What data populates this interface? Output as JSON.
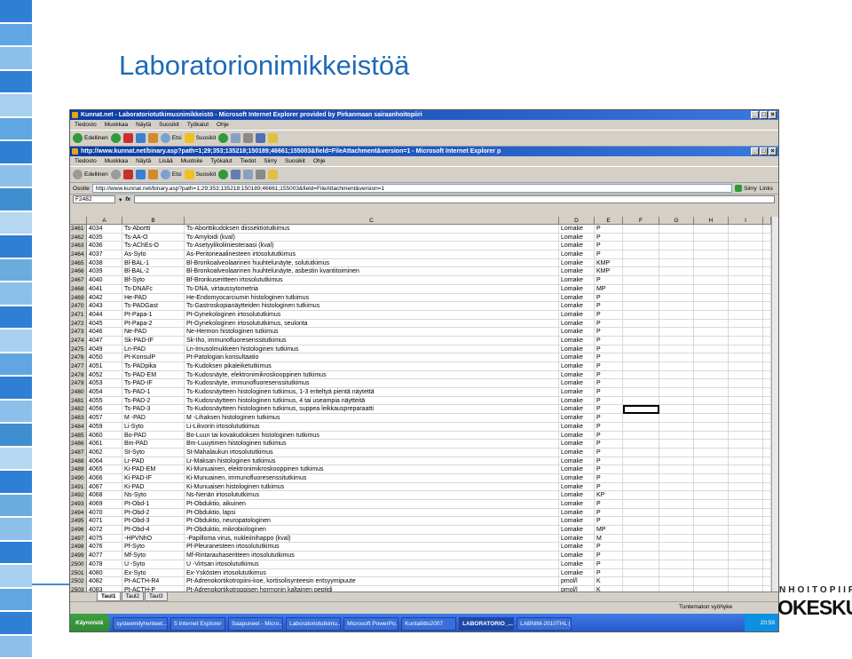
{
  "slide": {
    "title": "Laboratorionimikkeistöä"
  },
  "logo": {
    "top": "NHOITOPIIRI",
    "bottom": "OKESKUS"
  },
  "colors": {
    "stripe": [
      "#2f7fd4",
      "#5fa6e2",
      "#8cc0ea",
      "#2f7fd4",
      "#a8d0f0",
      "#5fa6e2",
      "#2f7fd4",
      "#8cc0ea",
      "#3f8fd0",
      "#b5d7f2",
      "#2f7fd4",
      "#6aacde",
      "#8cc0ea",
      "#2f7fd4",
      "#a8d0f0",
      "#5fa6e2",
      "#2f7fd4",
      "#8cc0ea",
      "#3f8fd0",
      "#b5d7f2",
      "#2f7fd4",
      "#6aacde",
      "#8cc0ea",
      "#2f7fd4",
      "#a8d0f0",
      "#5fa6e2",
      "#2f7fd4",
      "#8cc0ea"
    ],
    "accent": "#1e6ab8"
  },
  "browser1": {
    "title": "Kunnat.net - Laboratoriotutkimusnimikkeistö - Microsoft Internet Explorer provided by Pirkanmaan sairaanhoitopiiri",
    "menu": [
      "Tiedosto",
      "Muokkaa",
      "Näytä",
      "Suosikit",
      "Työkalut",
      "Ohje"
    ],
    "toolbar": {
      "back": "Edellinen",
      "search": "Etsi",
      "favorites": "Suosikit"
    }
  },
  "browser2": {
    "title": "http://www.kunnat.net/binary.asp?path=1;29;353;135218;150189;46661;155003&field=FileAttachment&version=1 - Microsoft Internet Explorer p",
    "menu": [
      "Tiedosto",
      "Muokkaa",
      "Näytä",
      "Lisää",
      "Muotoile",
      "Työkalut",
      "Tiedot",
      "Siirry",
      "Suosikit",
      "Ohje"
    ],
    "toolbar": {
      "back": "Edellinen",
      "search": "Etsi",
      "favorites": "Suosikit"
    },
    "address_label": "Osoite",
    "address": "http://www.kunnat.net/binary.asp?path=1;29;353;135218;150189;46661;155003&field=FileAttachment&version=1",
    "go": "Siirry",
    "links": "Links"
  },
  "excel": {
    "namebox": "F2482",
    "fx": "fx",
    "columns": [
      "",
      "A",
      "B",
      "C",
      "D",
      "E",
      "F",
      "G",
      "H",
      "I",
      ""
    ],
    "rows": [
      [
        "2461",
        "4034",
        "Ts-Abortti",
        "Ts-Aborttikudoksen diissektiotutkimus",
        "Lomake",
        "P"
      ],
      [
        "2462",
        "4035",
        "Ts-AA-O",
        "Ts-Amyloidi (kval)",
        "Lomake",
        "P"
      ],
      [
        "2463",
        "4036",
        "Ts-AChEs-O",
        "Ts-Asetyylikoliiniesteraasi (kval)",
        "Lomake",
        "P"
      ],
      [
        "2464",
        "4037",
        "As-Syto",
        "As-Peritoneaalinesteen irtosolututkimus",
        "Lomake",
        "P"
      ],
      [
        "2465",
        "4038",
        "Bl-BAL-1",
        "Bl-Bronkoalveolaarinen huuhtelunäyte, solututkimus",
        "Lomake",
        "KMP"
      ],
      [
        "2466",
        "4039",
        "Bl-BAL-2",
        "Bl-Bronkoalveolaarinen huuhtelunäyte, asbestin kvantitoiminen",
        "Lomake",
        "KMP"
      ],
      [
        "2467",
        "4040",
        "Bf-Syto",
        "Bf-Bronkusеritteen irtosolututkimus",
        "Lomake",
        "P"
      ],
      [
        "2468",
        "4041",
        "Ts-DNAFc",
        "Ts-DNA, virtaussytometria",
        "Lomake",
        "MP"
      ],
      [
        "2469",
        "4042",
        "He-PAD",
        "He-Endomyocarciumin histologinen tutkimus",
        "Lomake",
        "P"
      ],
      [
        "2470",
        "4043",
        "Ts-PADGast",
        "Ts-Gastroskopianäytteiden histologinen tutkimus",
        "Lomake",
        "P"
      ],
      [
        "2471",
        "4044",
        "Pt-Papa-1",
        "Pt-Gynekologinen irtosolututkimus",
        "Lomake",
        "P"
      ],
      [
        "2472",
        "4045",
        "Pt-Papa-2",
        "Pt-Gynekologinen irtosolututkimus, seulonta",
        "Lomake",
        "P"
      ],
      [
        "2473",
        "4046",
        "Ne-PAD",
        "Ne-Hermon histologinen tutkimus",
        "Lomake",
        "P"
      ],
      [
        "2474",
        "4047",
        "Sk-PAD-IF",
        "Sk-Iho, immunofluoresenssitutkimus",
        "Lomake",
        "P"
      ],
      [
        "2475",
        "4049",
        "Ln-PAD",
        "Ln-Imusolmukkeen histologinen tutkimus",
        "Lomake",
        "P"
      ],
      [
        "2476",
        "4050",
        "Pt-KonsulP",
        "Pt-Patologian konsultaatio",
        "Lomake",
        "P"
      ],
      [
        "2477",
        "4051",
        "Ts-PADpika",
        "Ts-Kudoksen pikaleiketutkimus",
        "Lomake",
        "P"
      ],
      [
        "2478",
        "4052",
        "Ts-PAD-EM",
        "Ts-Kudosnäyte, elektronimikroskooppinen tutkimus",
        "Lomake",
        "P"
      ],
      [
        "2479",
        "4053",
        "Ts-PAD-IF",
        "Ts-Kudosnäyte, immunofluoresenssitutkimus",
        "Lomake",
        "P"
      ],
      [
        "2480",
        "4054",
        "Ts-PAD-1",
        "Ts-Kudosnäytteen histologinen tutkimus, 1-3 eriteltyä pientä näytettä",
        "Lomake",
        "P"
      ],
      [
        "2481",
        "4055",
        "Ts-PAD-2",
        "Ts-Kudosnäytteen histologinen tutkimus, 4 tai useampia näytteitä",
        "Lomake",
        "P"
      ],
      [
        "2482",
        "4056",
        "Ts-PAD-3",
        "Ts-Kudosnäytteen histologinen tutkimus, suppea leikkauspreparaatti",
        "Lomake",
        "P"
      ],
      [
        "2483",
        "4057",
        "M -PAD",
        "M -Lihaksen histologinen tutkimus",
        "Lomake",
        "P"
      ],
      [
        "2484",
        "4059",
        "Li-Syto",
        "Li-Likvorin irtosolututkimus",
        "Lomake",
        "P"
      ],
      [
        "2485",
        "4060",
        "Bo-PAD",
        "Bo-Luun tai kovakudoksen histologinen tutkimus",
        "Lomake",
        "P"
      ],
      [
        "2486",
        "4061",
        "Bm-PAD",
        "Bm-Luuytimen histologinen tutkimus",
        "Lomake",
        "P"
      ],
      [
        "2487",
        "4062",
        "St-Syto",
        "St-Mahalaukun irtosolututkimus",
        "Lomake",
        "P"
      ],
      [
        "2488",
        "4064",
        "Lr-PAD",
        "Lr-Maksan histologinen tutkimus",
        "Lomake",
        "P"
      ],
      [
        "2489",
        "4065",
        "Ki-PAD-EM",
        "Ki-Munuainen, elektronimikroskooppinen tutkimus",
        "Lomake",
        "P"
      ],
      [
        "2490",
        "4066",
        "Ki-PAD-IF",
        "Ki-Munuainen, immunofluoresenssitutkimus",
        "Lomake",
        "P"
      ],
      [
        "2491",
        "4067",
        "Ki-PAD",
        "Ki-Munuaisen histologinen tutkimus",
        "Lomake",
        "P"
      ],
      [
        "2492",
        "4068",
        "Ns-Syto",
        "Ns-Nenän irtosolututkimus",
        "Lomake",
        "KP"
      ],
      [
        "2493",
        "4069",
        "Pt-Obd-1",
        "Pt-Obduktio, aikuinen",
        "Lomake",
        "P"
      ],
      [
        "2494",
        "4070",
        "Pt-Obd-2",
        "Pt-Obduktio, lapsi",
        "Lomake",
        "P"
      ],
      [
        "2495",
        "4071",
        "Pt-Obd-3",
        "Pt-Obduktio, neuropatologinen",
        "Lomake",
        "P"
      ],
      [
        "2496",
        "4072",
        "Pt-Obd-4",
        "Pt-Obduktio, mikrobiologinen",
        "Lomake",
        "MP"
      ],
      [
        "2497",
        "4075",
        "-HPVNhO",
        "-Papilloma virus, nukleiinihappo (kval)",
        "Lomake",
        "M"
      ],
      [
        "2498",
        "4076",
        "Pf-Syto",
        "Pf-Pleuranesteen irtosolututkimus",
        "Lomake",
        "P"
      ],
      [
        "2499",
        "4077",
        "Mf-Syto",
        "Mf-Rintarauhaseritteen irtosolututkimus",
        "Lomake",
        "P"
      ],
      [
        "2500",
        "4078",
        "U -Syto",
        "U -Virtsan irtosolututkimus",
        "Lomake",
        "P"
      ],
      [
        "2501",
        "4080",
        "Ex-Syto",
        "Ex-Yskösten irtosolututkimus",
        "Lomake",
        "P"
      ],
      [
        "2502",
        "4082",
        "Pt-ACTH-R4",
        "Pt-Adrenokortikotropiini-koe, kortisolisynteesin entsyymipuute",
        "pmol/l",
        "K"
      ],
      [
        "2503",
        "4083",
        "Pt-ACTH-P",
        "Pt-Adrenokortikotroppisen hormonin kaltainen peptidi",
        "pmol/l",
        "K"
      ]
    ],
    "tabs": [
      "Taul1",
      "Taul2",
      "Taul3"
    ],
    "status": "Tuntematon vyöhyke"
  },
  "taskbar": {
    "start": "Käynnistä",
    "tasks": [
      "systeemilyhenteet...",
      "5 Internet Explorer",
      "Saapuneet - Micro...",
      "Laboratoriotutkimu...",
      "Microsoft PowerPo...",
      "Kuntaliitto2007",
      "LABORATORIO_...",
      "LABNIM-2010THL (2)"
    ],
    "active_task": 6,
    "clock": "20:59"
  }
}
